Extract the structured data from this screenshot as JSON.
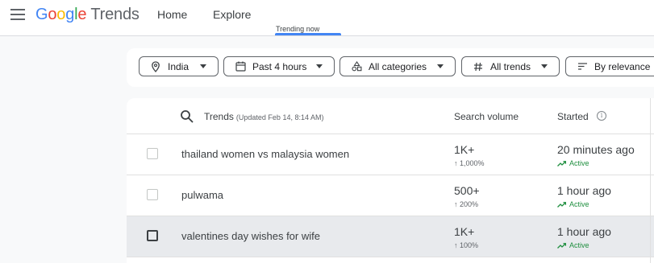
{
  "header": {
    "logo_letters": [
      "G",
      "o",
      "o",
      "g",
      "l",
      "e"
    ],
    "logo_word": "Trends",
    "nav": [
      {
        "label": "Home"
      },
      {
        "label": "Explore"
      },
      {
        "label": "Trending now"
      }
    ],
    "active_tab": "Trending now"
  },
  "filters": [
    {
      "label": "India",
      "icon": "location-pin-icon"
    },
    {
      "label": "Past 4 hours",
      "icon": "calendar-icon"
    },
    {
      "label": "All categories",
      "icon": "categories-icon"
    },
    {
      "label": "All trends",
      "icon": "hashtag-icon"
    },
    {
      "label": "By relevance",
      "icon": "sort-icon"
    }
  ],
  "table": {
    "col_trends": "Trends",
    "updated": "(Updated Feb 14, 8:14 AM)",
    "col_volume": "Search volume",
    "col_started": "Started",
    "rows": [
      {
        "name": "thailand women vs malaysia women",
        "volume": "1K+",
        "change": "↑ 1,000%",
        "started": "20 minutes ago",
        "status": "Active"
      },
      {
        "name": "pulwama",
        "volume": "500+",
        "change": "↑ 200%",
        "started": "1 hour ago",
        "status": "Active"
      },
      {
        "name": "valentines day wishes for wife",
        "volume": "1K+",
        "change": "↑ 100%",
        "started": "1 hour ago",
        "status": "Active"
      }
    ]
  },
  "colors": {
    "accent": "#4285f4",
    "active_green": "#1e8e3e",
    "row_highlight": "#e8eaed"
  }
}
